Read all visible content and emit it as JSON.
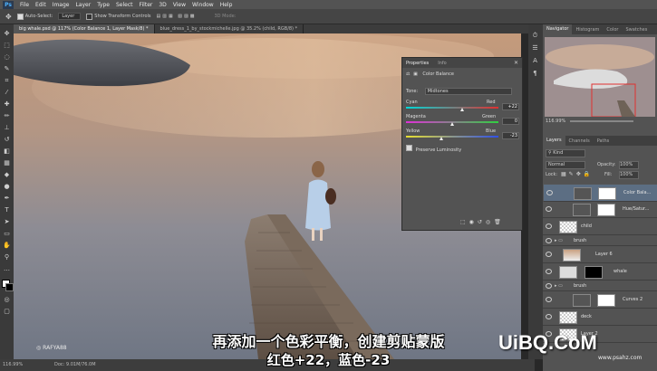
{
  "menu": [
    "File",
    "Edit",
    "Image",
    "Layer",
    "Type",
    "Select",
    "Filter",
    "3D",
    "View",
    "Window",
    "Help"
  ],
  "options": {
    "auto_select": "Auto-Select:",
    "layer_dropdown": "Layer",
    "show_transform": "Show Transform Controls",
    "mode_3d": "3D Mode:"
  },
  "doc_tabs": [
    {
      "label": "big whale.psd @ 117% (Color Balance 1, Layer Mask/8) *"
    },
    {
      "label": "blue_dress_1_by_stockmichelle.jpg @ 35.2% (child, RGB/8) *"
    }
  ],
  "properties": {
    "tabs": [
      "Properties",
      "Info"
    ],
    "title": "Color Balance",
    "tone_label": "Tone:",
    "tone_value": "Midtones",
    "sliders": [
      {
        "left": "Cyan",
        "right": "Red",
        "value": "+22",
        "pos": 0.61
      },
      {
        "left": "Magenta",
        "right": "Green",
        "value": "0",
        "pos": 0.5
      },
      {
        "left": "Yellow",
        "right": "Blue",
        "value": "-23",
        "pos": 0.385
      }
    ],
    "preserve": "Preserve Luminosity"
  },
  "navigator": {
    "tabs": [
      "Navigator",
      "Histogram",
      "Color",
      "Swatches"
    ],
    "zoom": "116.99%"
  },
  "layers_panel": {
    "tabs": [
      "Layers",
      "Channels",
      "Paths"
    ],
    "kind": "Kind",
    "blend": "Normal",
    "opacity_label": "Opacity:",
    "opacity": "100%",
    "lock_label": "Lock:",
    "fill_label": "Fill:",
    "fill": "100%",
    "layers": [
      {
        "name": "Color Bala...",
        "selected": true
      },
      {
        "name": "Hue/Satur...",
        "selected": false
      },
      {
        "name": "child",
        "selected": false
      },
      {
        "name": "brush",
        "selected": false
      },
      {
        "name": "Layer 6",
        "selected": false
      },
      {
        "name": "whale",
        "selected": false
      },
      {
        "name": "brush",
        "selected": false
      },
      {
        "name": "Curves 2",
        "selected": false
      },
      {
        "name": "deck",
        "selected": false
      },
      {
        "name": "Layer 2",
        "selected": false
      }
    ]
  },
  "status": {
    "zoom": "116.99%",
    "doc": "Doc: 9.01M/76.0M"
  },
  "watermark": "RAFYA88",
  "subtitles": {
    "line1": "再添加一个色彩平衡，创建剪贴蒙版",
    "line2": "红色+22，蓝色-23"
  },
  "logo": {
    "text": "UiBQ.CoM",
    "url": "www.psahz.com"
  }
}
